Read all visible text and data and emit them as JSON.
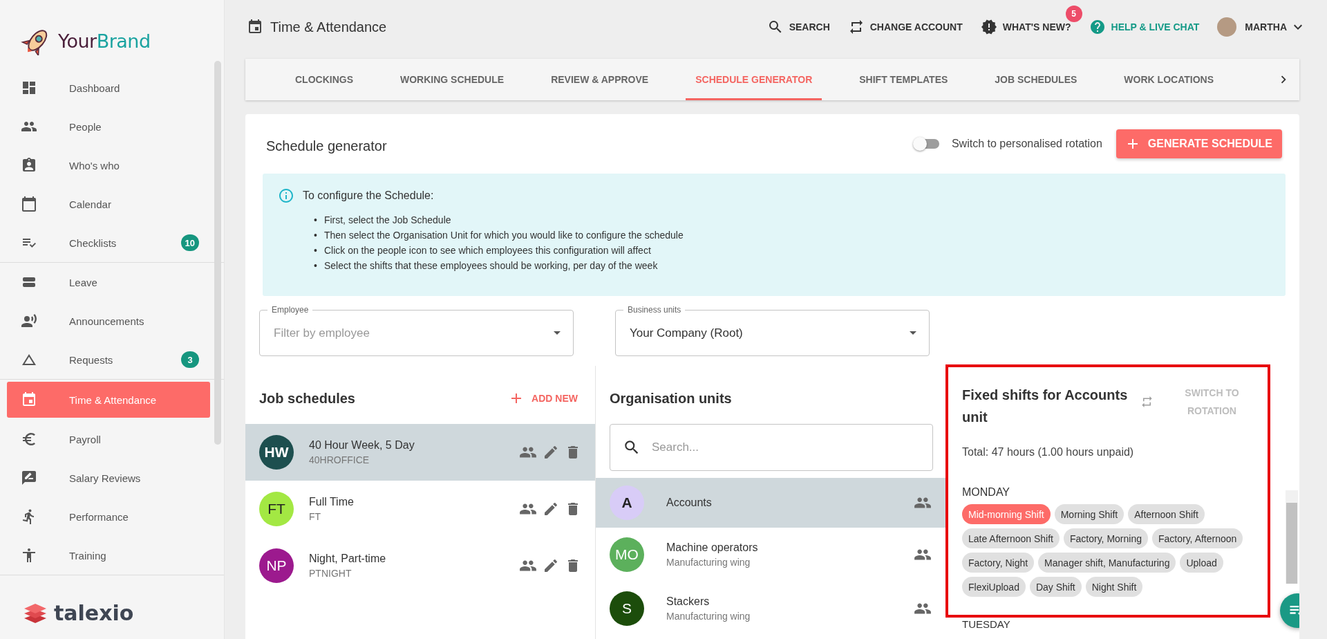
{
  "brand": {
    "part_1": "Your",
    "part_2": "Brand"
  },
  "sidebar": {
    "groups": [
      [
        {
          "label": "Dashboard",
          "selected": false
        },
        {
          "label": "People",
          "selected": false
        },
        {
          "label": "Who's who",
          "selected": false
        },
        {
          "label": "Calendar",
          "selected": false
        },
        {
          "label": "Checklists",
          "badge": "10",
          "selected": false
        }
      ],
      [
        {
          "label": "Leave",
          "selected": false
        },
        {
          "label": "Announcements",
          "selected": false
        },
        {
          "label": "Requests",
          "badge": "3",
          "selected": false
        }
      ],
      [
        {
          "label": "Time & Attendance",
          "selected": true
        },
        {
          "label": "Payroll",
          "selected": false
        },
        {
          "label": "Salary Reviews",
          "selected": false
        },
        {
          "label": "Performance",
          "selected": false
        },
        {
          "label": "Training",
          "selected": false
        }
      ]
    ]
  },
  "footer_logo": "talexio",
  "header": {
    "title": "Time & Attendance",
    "actions": [
      {
        "label": "SEARCH",
        "highlighted": false
      },
      {
        "label": "CHANGE ACCOUNT",
        "highlighted": false
      },
      {
        "label": "WHAT'S NEW?",
        "badge": "5",
        "highlighted": false
      },
      {
        "label": "HELP & LIVE CHAT",
        "highlighted": true
      }
    ],
    "user": "MARTHA"
  },
  "tabs": [
    {
      "label": "CLOCKINGS",
      "selected": false
    },
    {
      "label": "WORKING SCHEDULE",
      "selected": false
    },
    {
      "label": "REVIEW & APPROVE",
      "selected": false
    },
    {
      "label": "SCHEDULE GENERATOR",
      "selected": true
    },
    {
      "label": "SHIFT TEMPLATES",
      "selected": false
    },
    {
      "label": "JOB SCHEDULES",
      "selected": false
    },
    {
      "label": "WORK LOCATIONS",
      "selected": false
    }
  ],
  "card": {
    "title": "Schedule generator",
    "toggle": {
      "label": "Switch to personalised rotation",
      "on": false
    },
    "generate_button": "GENERATE SCHEDULE"
  },
  "info": {
    "title": "To configure the Schedule:",
    "marker": "•",
    "bullets": [
      "First, select the Job Schedule",
      "Then select the Organisation Unit for which you would like to configure the schedule",
      "Click on the people icon to see which employees this configuration will affect",
      "Select the shifts that these employees should be working, per day of the week"
    ]
  },
  "filters": [
    {
      "label": "Employee",
      "placeholder": "Filter by employee"
    },
    {
      "label": "Business units",
      "value": "Your Company (Root)"
    }
  ],
  "job_schedules": {
    "title": "Job schedules",
    "add_label": "ADD NEW",
    "rows": [
      {
        "initials": "HW",
        "name": "40 Hour Week, 5 Day",
        "code": "40HROFFICE",
        "color": "#1d4f4f",
        "selected": true
      },
      {
        "initials": "FT",
        "name": "Full Time",
        "code": "FT",
        "color": "#a3e843",
        "selected": false
      },
      {
        "initials": "NP",
        "name": "Night, Part-time",
        "code": "PTNIGHT",
        "color": "#9c1a8e",
        "selected": false
      }
    ]
  },
  "org_units": {
    "title": "Organisation units",
    "search_placeholder": "Search...",
    "rows": [
      {
        "initials": "A",
        "name": "Accounts",
        "color": "#d8ccf7",
        "selected": true
      },
      {
        "initials": "MO",
        "name": "Machine operators",
        "subtitle": "Manufacturing wing",
        "color": "#5cb05c",
        "selected": false
      },
      {
        "initials": "S",
        "name": "Stackers",
        "subtitle": "Manufacturing wing",
        "color": "#1c4d0b",
        "selected": false
      }
    ]
  },
  "fixed_shifts": {
    "title": "Fixed shifts for Accounts unit",
    "switch_label": "SWITCH TO ROTATION",
    "total": "Total: 47 hours (1.00 hours unpaid)",
    "days": [
      {
        "name": "MONDAY",
        "shifts": [
          {
            "label": "Mid-morning Shift",
            "selected": true
          },
          {
            "label": "Morning Shift",
            "selected": false
          },
          {
            "label": "Afternoon Shift",
            "selected": false
          },
          {
            "label": "Late Afternoon Shift",
            "selected": false
          },
          {
            "label": "Factory, Morning",
            "selected": false
          },
          {
            "label": "Factory, Afternoon",
            "selected": false
          },
          {
            "label": "Factory, Night",
            "selected": false
          },
          {
            "label": "Manager shift, Manufacturing",
            "selected": false
          },
          {
            "label": "Upload",
            "selected": false
          },
          {
            "label": "FlexiUpload",
            "selected": false
          },
          {
            "label": "Day Shift",
            "selected": false
          },
          {
            "label": "Night Shift",
            "selected": false
          }
        ]
      },
      {
        "name": "TUESDAY"
      }
    ]
  }
}
